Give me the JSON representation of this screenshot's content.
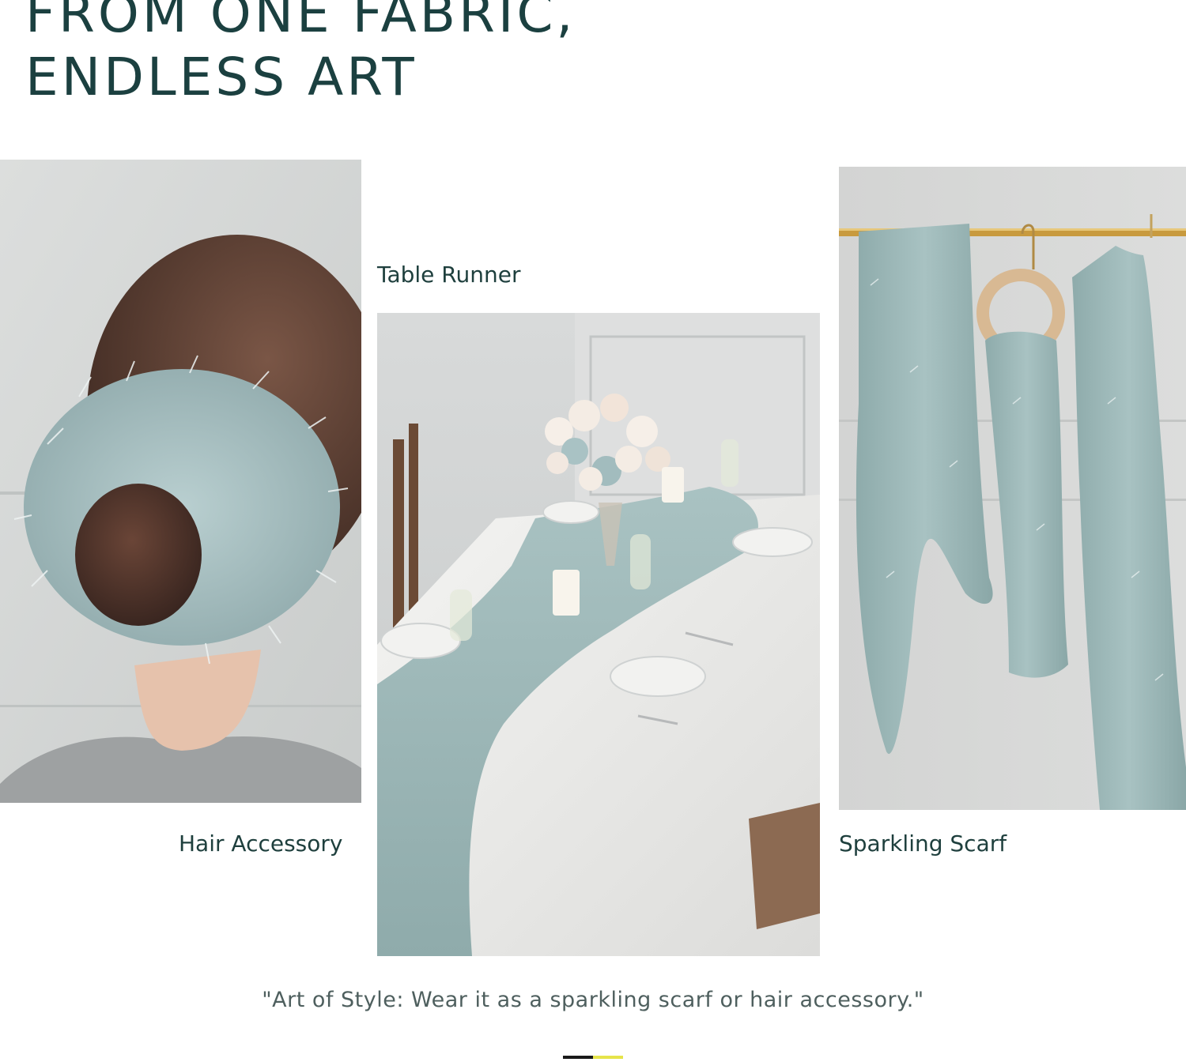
{
  "headline": {
    "line1": "FROM ONE FABRIC,",
    "line2": "ENDLESS ART"
  },
  "panels": {
    "hair": {
      "caption": "Hair Accessory",
      "icon": "hair-scrunchie-photo"
    },
    "table": {
      "caption": "Table Runner",
      "icon": "table-runner-photo"
    },
    "scarf": {
      "caption": "Sparkling Scarf",
      "icon": "hanging-scarf-photo"
    }
  },
  "quote": "\"Art of Style: Wear it as a sparkling scarf or hair accessory.\"",
  "pager": {
    "active_color": "#1a1a1a",
    "inactive_color": "#e6e44a"
  },
  "colors": {
    "heading": "#1b4040",
    "fabric": "#9cb8b6",
    "background": "#ffffff"
  }
}
